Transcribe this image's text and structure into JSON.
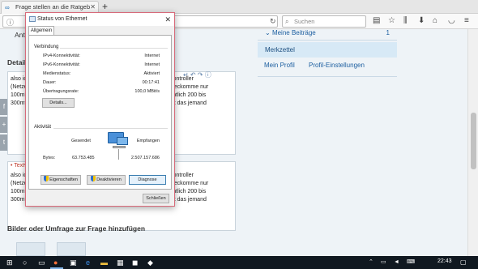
{
  "browser": {
    "tab_title": "Frage stellen an die Ratgeb",
    "tab_close": "✕",
    "new_tab": "+",
    "search_placeholder": "Suchen",
    "icons": [
      "reader-icon",
      "bookmark-star-icon",
      "library-icon",
      "download-icon",
      "home-icon",
      "pocket-icon",
      "menu-icon"
    ]
  },
  "page": {
    "answer_fragment": "Antw",
    "details_fragment": "Details",
    "editor1_lines_left": [
      "also ic",
      "(Netze",
      "100mb",
      "300mt"
    ],
    "editor1_lines_right": [
      "lly Controller",
      "ich beckomme nur",
      "eigentlich 200 bis",
      "weißt das jemand"
    ],
    "text_label": "Textvo",
    "editor2_lines_left": [
      "also ic",
      "(Netze",
      "100mb",
      "300mb"
    ],
    "editor2_lines_right": [
      "lly Controller",
      "ich beckomme nur",
      "eigentlich 200 bis",
      "weißt das jemand"
    ],
    "bottom_heading": "Bilder oder Umfrage zur Frage hinzufügen",
    "right_panel": {
      "meine_beitraege": "Meine Beiträge",
      "meine_beitraege_count": "1",
      "merkzettel": "Merkzettel",
      "mein_profil": "Mein Profil",
      "profil_einstellungen": "Profil-Einstellungen"
    }
  },
  "dialog": {
    "title": "Status von Ethernet",
    "close_glyph": "✕",
    "tab_general": "Allgemein",
    "connection_group": "Verbindung",
    "rows": [
      {
        "label": "IPv4-Konnektivität:",
        "value": "Internet"
      },
      {
        "label": "IPv6-Konnektivität:",
        "value": "Internet"
      },
      {
        "label": "Medienstatus:",
        "value": "Aktiviert"
      },
      {
        "label": "Dauer:",
        "value": "00:17:41"
      },
      {
        "label": "Übertragungsrate:",
        "value": "100,0 MBit/s"
      }
    ],
    "details_button": "Details...",
    "activity_group": "Aktivität",
    "sent_label": "Gesendet",
    "received_label": "Empfangen",
    "bytes_label": "Bytes:",
    "bytes_sent": "63.753.485",
    "bytes_received": "2.507.157.686",
    "properties_button": "Eigenschaften",
    "deactivate_button": "Deaktivieren",
    "diagnose_button": "Diagnose",
    "close_button": "Schließen"
  },
  "taskbar": {
    "clock": "22:43"
  },
  "colors": {
    "accent_blue": "#1d5fa0",
    "panel_blue": "#d7e9f6",
    "dialog_border": "#d86a7a",
    "taskbar": "#101820"
  }
}
